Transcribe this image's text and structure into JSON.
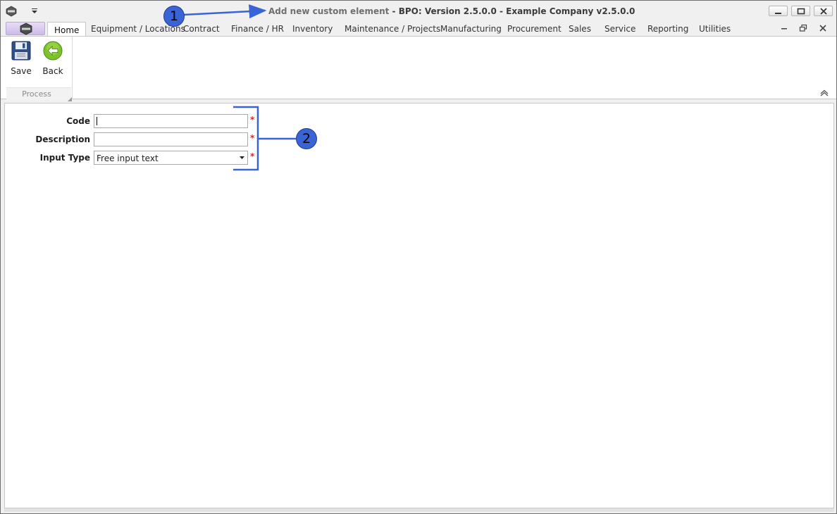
{
  "titlebar": {
    "title_part1": "Add new custom element",
    "title_part2": " - BPO: Version 2.5.0.0 - Example Company v2.5.0.0"
  },
  "tabs": [
    {
      "label": "Home",
      "active": true
    },
    {
      "label": "Equipment / Locations"
    },
    {
      "label": "Contract"
    },
    {
      "label": "Finance / HR"
    },
    {
      "label": "Inventory"
    },
    {
      "label": "Maintenance / Projects"
    },
    {
      "label": "Manufacturing"
    },
    {
      "label": "Procurement"
    },
    {
      "label": "Sales"
    },
    {
      "label": "Service"
    },
    {
      "label": "Reporting"
    },
    {
      "label": "Utilities"
    }
  ],
  "ribbon": {
    "save_label": "Save",
    "back_label": "Back",
    "group_label": "Process"
  },
  "form": {
    "code_label": "Code",
    "code_value": "",
    "description_label": "Description",
    "description_value": "",
    "input_type_label": "Input Type",
    "input_type_value": "Free input text",
    "required_marker": "*"
  },
  "annotations": {
    "badge1": "1",
    "badge2": "2",
    "color": "#3a64d6"
  },
  "icons": [
    "app-logo-icon",
    "dropdown-arrow-icon",
    "minimize-icon",
    "restore-icon",
    "close-icon",
    "floppy-disk-icon",
    "back-arrow-icon",
    "ribbon-collapse-icon",
    "dialog-launcher-icon"
  ]
}
